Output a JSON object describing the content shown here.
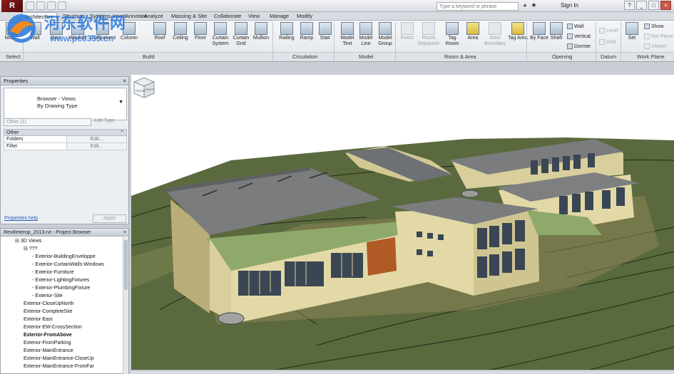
{
  "window": {
    "search_placeholder": "Type a keyword or phrase",
    "sign_in": "Sign In",
    "app_logo": "R"
  },
  "watermark": {
    "text": "河东软件网",
    "url": "www.pc0359.cn"
  },
  "ribbon": {
    "tabs": [
      "Architecture",
      "Structure",
      "Systems",
      "Insert",
      "Annotate",
      "Analyze",
      "Massing & Site",
      "Collaborate",
      "View",
      "Manage",
      "Modify"
    ],
    "active_tab": "Architecture",
    "buttons": {
      "modify": "Modify",
      "wall": "Wall",
      "door": "Door",
      "window": "Window",
      "component": "Component",
      "column": "Column",
      "roof": "Roof",
      "ceiling": "Ceiling",
      "floor": "Floor",
      "curtain_system": "Curtain System",
      "curtain_grid": "Curtain Grid",
      "mullion": "Mullion",
      "railing": "Railing",
      "ramp": "Ramp",
      "stair": "Stair",
      "model_text": "Model Text",
      "model_line": "Model Line",
      "model_group": "Model Group",
      "room": "Room",
      "room_separator": "Room Separator",
      "tag_room": "Tag Room",
      "area": "Area",
      "area_boundary": "Area Boundary",
      "tag_area": "Tag Area",
      "by_face": "By Face",
      "shaft": "Shaft",
      "wall_opening": "Wall",
      "vertical": "Vertical",
      "dormer": "Dormer",
      "level": "Level",
      "grid": "Grid",
      "set": "Set",
      "show": "Show",
      "ref_plane": "Ref Plane",
      "viewer": "Viewer"
    },
    "panels": {
      "select": "Select",
      "build": "Build",
      "circulation": "Circulation",
      "model": "Model",
      "room_area": "Room & Area",
      "opening": "Opening",
      "datum": "Datum",
      "work_plane": "Work Plane"
    }
  },
  "properties": {
    "title": "Properties",
    "type_line1": "Browser - Views",
    "type_line2": "By Drawing Type",
    "instance_filter": "Other (1)",
    "edit_type": "Edit Type",
    "category": "Other",
    "rows": [
      {
        "key": "Folders",
        "value": "Edit..."
      },
      {
        "key": "Filter",
        "value": "Edit..."
      }
    ],
    "help": "Properties help",
    "apply": "Apply"
  },
  "browser": {
    "title": "RevitInterop_2013.rvt - Project Browser",
    "items": [
      {
        "label": "3D Views",
        "indent": 1,
        "prefix": "⊟"
      },
      {
        "label": "???",
        "indent": 2,
        "prefix": "⊟"
      },
      {
        "label": "Exterior-BuildingEnveloppe",
        "indent": 3,
        "prefix": "-"
      },
      {
        "label": "Exterior-CurtainWalls-Windows",
        "indent": 3,
        "prefix": "-"
      },
      {
        "label": "Exterior-Furniture",
        "indent": 3,
        "prefix": "-"
      },
      {
        "label": "Exterior-LightingFixtures",
        "indent": 3,
        "prefix": "-"
      },
      {
        "label": "Exterior-PlumbingFixture",
        "indent": 3,
        "prefix": "-"
      },
      {
        "label": "Exterior-Site",
        "indent": 3,
        "prefix": "-"
      },
      {
        "label": "Exterior-CloseUpNorth",
        "indent": 2,
        "prefix": ""
      },
      {
        "label": "Exterior-CompleteSite",
        "indent": 2,
        "prefix": ""
      },
      {
        "label": "Exterior-East",
        "indent": 2,
        "prefix": ""
      },
      {
        "label": "Exterior-EW-CrossSection",
        "indent": 2,
        "prefix": ""
      },
      {
        "label": "Exterior-FromAbove",
        "indent": 2,
        "prefix": "",
        "bold": true
      },
      {
        "label": "Exterior-FromParking",
        "indent": 2,
        "prefix": ""
      },
      {
        "label": "Exterior-MainEntrance",
        "indent": 2,
        "prefix": ""
      },
      {
        "label": "Exterior-MainEntrance-CloseUp",
        "indent": 2,
        "prefix": ""
      },
      {
        "label": "Exterior-MainEntrance-FromFar",
        "indent": 2,
        "prefix": ""
      }
    ]
  },
  "viewcube": {
    "face_top": "FRONT",
    "face_right": "RIGHT"
  },
  "colors": {
    "ground": "#5b6a3e",
    "contour": "#2a3320",
    "roof": "#7a7c7e",
    "roof_dark": "#5e6062",
    "wall": "#e3d9a6",
    "wall_shade": "#b9ad78",
    "glass": "#3a4654",
    "green_roof": "#8fa96a"
  }
}
